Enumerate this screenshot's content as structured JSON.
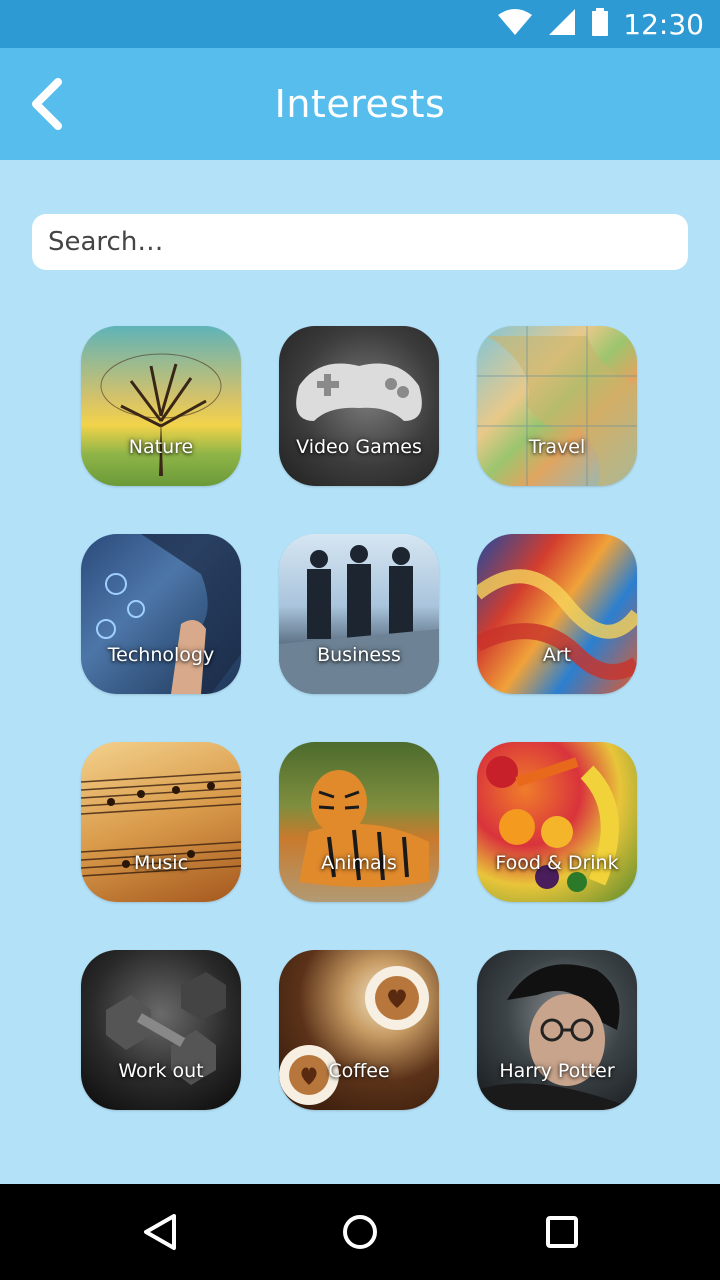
{
  "status_bar": {
    "time": "12:30",
    "icons": [
      "wifi-icon",
      "signal-icon",
      "battery-icon"
    ]
  },
  "app_bar": {
    "title": "Interests",
    "back_icon": "chevron-left-icon"
  },
  "search": {
    "placeholder": "Search…",
    "value": ""
  },
  "interests": [
    {
      "label": "Nature"
    },
    {
      "label": "Video Games"
    },
    {
      "label": "Travel"
    },
    {
      "label": "Technology"
    },
    {
      "label": "Business"
    },
    {
      "label": "Art"
    },
    {
      "label": "Music"
    },
    {
      "label": "Animals"
    },
    {
      "label": "Food & Drink"
    },
    {
      "label": "Work out"
    },
    {
      "label": "Coffee"
    },
    {
      "label": "Harry Potter"
    }
  ],
  "nav_bar": {
    "icons": [
      "back-triangle-icon",
      "home-circle-icon",
      "recents-square-icon"
    ]
  },
  "colors": {
    "status_bar": "#2e9ad4",
    "app_bar": "#56bdec",
    "background": "#b3e1f8",
    "nav_bar": "#000000"
  }
}
